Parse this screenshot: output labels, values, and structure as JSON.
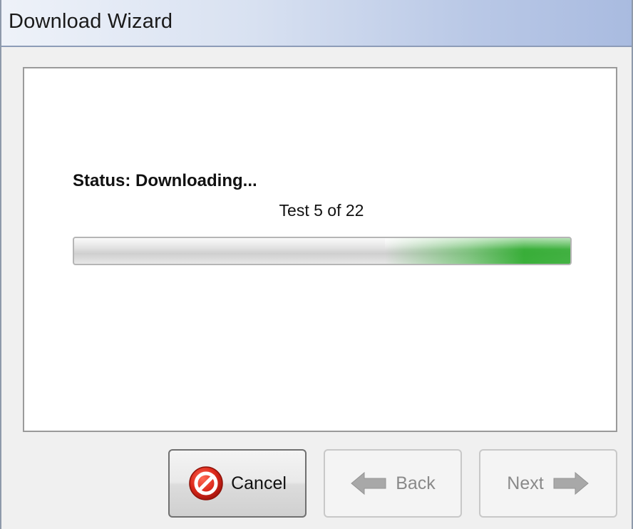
{
  "window": {
    "title": "Download Wizard"
  },
  "status": {
    "label": "Status: Downloading...",
    "test_counter": "Test 5 of 22"
  },
  "progress": {
    "state": "indeterminate-marquee",
    "color": "#3cb43c"
  },
  "buttons": {
    "cancel": {
      "label": "Cancel",
      "icon": "no-entry-icon",
      "enabled": true
    },
    "back": {
      "label": "Back",
      "icon": "arrow-left-icon",
      "enabled": false
    },
    "next": {
      "label": "Next",
      "icon": "arrow-right-icon",
      "enabled": false
    }
  },
  "colors": {
    "cancel_icon": "#d9261c",
    "disabled_arrow": "#a8a8a8"
  }
}
